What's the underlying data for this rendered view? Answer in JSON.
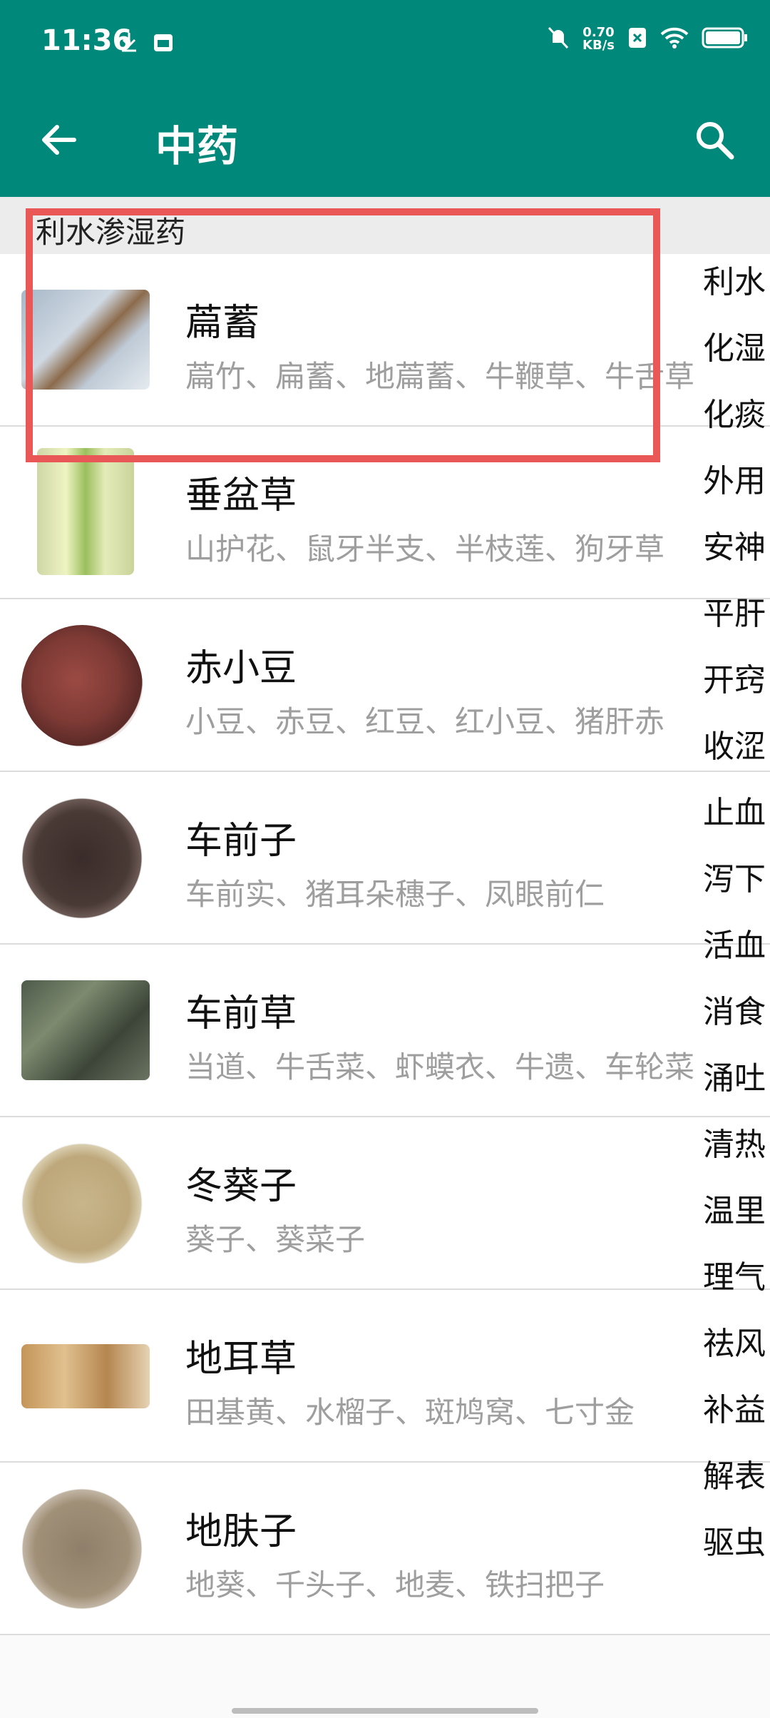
{
  "status_bar": {
    "time": "11:36",
    "net_speed_value": "0.70",
    "net_speed_unit": "KB/s"
  },
  "app_bar": {
    "title": "中药"
  },
  "section": {
    "title": "利水渗湿药"
  },
  "items": [
    {
      "name": "萹蓄",
      "alias": "萹竹、扁蓄、地萹蓄、牛鞭草、牛舌草"
    },
    {
      "name": "垂盆草",
      "alias": "山护花、鼠牙半支、半枝莲、狗牙草"
    },
    {
      "name": "赤小豆",
      "alias": "小豆、赤豆、红豆、红小豆、猪肝赤"
    },
    {
      "name": "车前子",
      "alias": "车前实、猪耳朵穗子、凤眼前仁"
    },
    {
      "name": "车前草",
      "alias": "当道、牛舌菜、虾蟆衣、牛遗、车轮菜"
    },
    {
      "name": "冬葵子",
      "alias": "葵子、葵菜子"
    },
    {
      "name": "地耳草",
      "alias": "田基黄、水榴子、斑鸠窝、七寸金"
    },
    {
      "name": "地肤子",
      "alias": "地葵、千头子、地麦、铁扫把子"
    }
  ],
  "index_bar": [
    "利水",
    "化湿",
    "化痰",
    "外用",
    "安神",
    "平肝",
    "开窍",
    "收涩",
    "止血",
    "泻下",
    "活血",
    "消食",
    "涌吐",
    "清热",
    "温里",
    "理气",
    "祛风",
    "补益",
    "解表",
    "驱虫"
  ],
  "colors": {
    "primary": "#00897b",
    "highlight": "#e95757"
  }
}
